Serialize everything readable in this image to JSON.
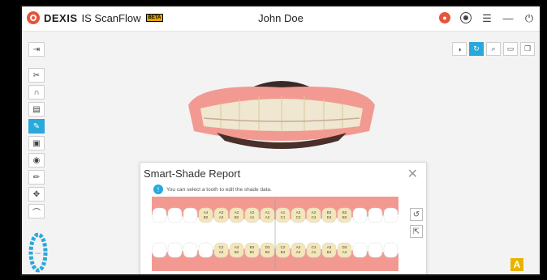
{
  "app": {
    "brand": "DEXIS",
    "product": "IS ScanFlow",
    "beta_badge": "BETA",
    "patient_name": "John Doe"
  },
  "colors": {
    "accent": "#29a8dc",
    "brand_orange": "#e6543a",
    "gum": "#f29a92",
    "tooth": "#f3e6b8",
    "tooth_empty": "#ffffff"
  },
  "top_icons": [
    "scan-status-icon",
    "record-icon",
    "menu-icon",
    "minimize-icon",
    "power-icon"
  ],
  "left_tools": [
    {
      "icon": "sign-out-icon",
      "active": false
    },
    {
      "icon": "trim-icon",
      "active": false
    },
    {
      "icon": "arch-icon",
      "active": false
    },
    {
      "icon": "document-icon",
      "active": false
    },
    {
      "icon": "smart-shade-icon",
      "active": true
    },
    {
      "icon": "camera-icon",
      "active": false
    },
    {
      "icon": "color-icon",
      "active": false
    },
    {
      "icon": "pen-icon",
      "active": false
    },
    {
      "icon": "move-icon",
      "active": false
    },
    {
      "icon": "curve-icon",
      "active": false
    }
  ],
  "view_tools": [
    {
      "icon": "contrast-icon",
      "active": false
    },
    {
      "icon": "rotate-icon",
      "active": true
    },
    {
      "icon": "zoom-icon",
      "active": false
    },
    {
      "icon": "box-icon",
      "active": false
    },
    {
      "icon": "layers-icon",
      "active": false
    }
  ],
  "report": {
    "title": "Smart-Shade Report",
    "info": "You can select a tooth to edit the shade data.",
    "upper_shades": [
      [
        "A4",
        "B2"
      ],
      [
        "A3",
        "A3"
      ],
      [
        "A2",
        "B2"
      ],
      [
        "A2",
        "A1"
      ],
      [
        "A1",
        "A2"
      ],
      [
        "A1",
        "C1"
      ],
      [
        "A2",
        "C2"
      ],
      [
        "A2",
        "C4"
      ],
      [
        "B3",
        "D4"
      ],
      [
        "B2",
        "B3"
      ]
    ],
    "lower_shades": [
      [
        "C2",
        "A4"
      ],
      [
        "A3",
        "B2"
      ],
      [
        "B3",
        "B1"
      ],
      [
        "D3",
        "B2"
      ],
      [
        "C2",
        "B4"
      ],
      [
        "A2",
        "A2"
      ],
      [
        "C3",
        "A1"
      ],
      [
        "A3",
        "B4"
      ],
      [
        "D3",
        "A4"
      ]
    ]
  },
  "badge_letter": "A"
}
